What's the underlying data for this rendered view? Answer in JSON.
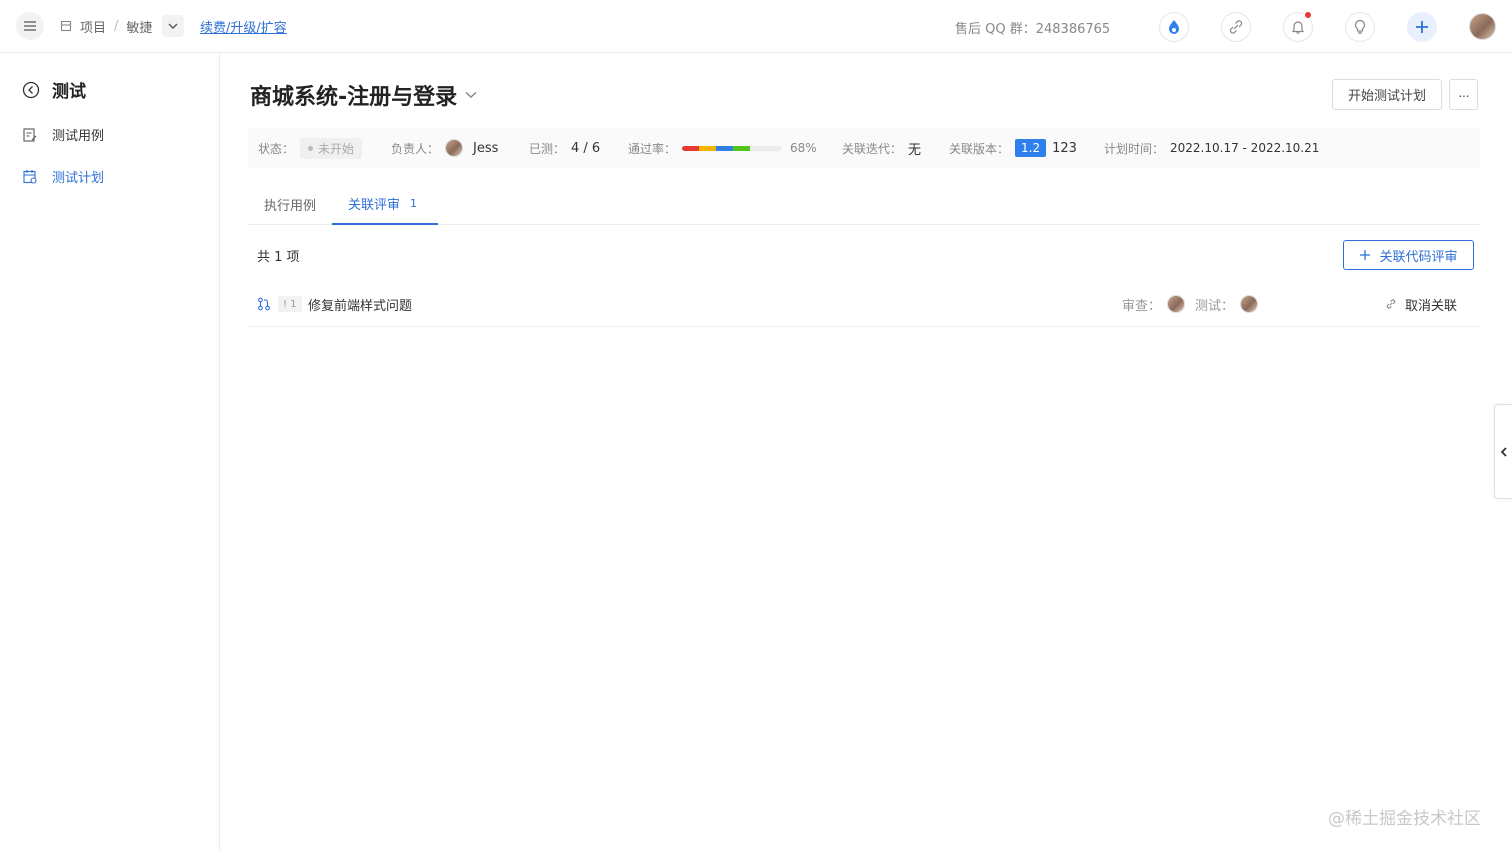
{
  "topbar": {
    "breadcrumb": [
      "项目",
      "敏捷"
    ],
    "breadcrumb_sep": "/",
    "renew_link": "续费/升级/扩容",
    "qq_group": "售后 QQ 群：248386765",
    "icons": [
      "menu-icon",
      "project-icon",
      "chevron-down-icon",
      "flame-icon",
      "link-icon",
      "bell-icon",
      "bulb-icon",
      "plus-icon",
      "user-avatar"
    ]
  },
  "sidebar": {
    "title": "测试",
    "items": [
      {
        "label": "测试用例",
        "icon": "test-case-icon",
        "active": false
      },
      {
        "label": "测试计划",
        "icon": "test-plan-icon",
        "active": true
      }
    ]
  },
  "main": {
    "plan_title": "商城系统-注册与登录",
    "start_button": "开始测试计划",
    "more_button": "···",
    "info": {
      "status_label": "状态：",
      "status_value": "未开始",
      "owner_label": "负责人：",
      "owner_name": "Jess",
      "tested_label": "已测：",
      "tested_value": "4 / 6",
      "pass_label": "通过率：",
      "pass_value": "68%",
      "pass_rate": 0.68,
      "pass_colors": [
        "#e53935",
        "#f5b400",
        "#2f80ed",
        "#52c41a"
      ],
      "iteration_label": "关联迭代：",
      "iteration_value": "无",
      "version_label": "关联版本：",
      "version_badge": "1.2",
      "version_value": "123",
      "time_label": "计划时间：",
      "time_value": "2022.10.17 - 2022.10.21"
    },
    "tabs": [
      {
        "label": "执行用例",
        "count": "",
        "active": false
      },
      {
        "label": "关联评审",
        "count": "1",
        "active": true
      }
    ],
    "total": "共 1 项",
    "link_review_button": "关联代码评审",
    "reviews": [
      {
        "id": "! 1",
        "title": "修复前端样式问题",
        "reviewer_label": "审查：",
        "tester_label": "测试：",
        "cancel": "取消关联"
      }
    ]
  },
  "watermark": "@稀土掘金技术社区",
  "colors": {
    "accent": "#2f6fd6",
    "badge": "#2f80ed"
  }
}
